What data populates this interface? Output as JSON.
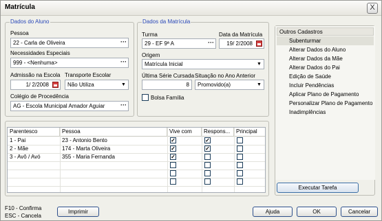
{
  "window": {
    "title": "Matrícula",
    "close": "X"
  },
  "aluno": {
    "legend": "Dados do Aluno",
    "pessoa_label": "Pessoa",
    "pessoa": "22 - Carla de Oliveira",
    "nec_label": "Necessidades Especiais",
    "nec": "999 - <Nenhuma>",
    "admissao_label": "Admissão na Escola",
    "admissao": "1/ 2/2008",
    "transporte_label": "Transporte Escolar",
    "transporte": "Não Utiliza",
    "colegio_label": "Colégio de Procedência",
    "colegio": "AG - Escola Municipal Amador Aguiar"
  },
  "matricula": {
    "legend": "Dados da Matrícula",
    "turma_label": "Turma",
    "turma": "29 - EF 9ª A",
    "data_label": "Data da Matrícula",
    "data": "19/ 2/2008",
    "origem_label": "Origem",
    "origem": "Matrícula Inicial",
    "serie_label": "Última Série Cursada",
    "serie": "8",
    "situacao_label": "Situação no Ano Anterior",
    "situacao": "Promovido(a)",
    "bolsa_label": "Bolsa Família",
    "bolsa_checked": false
  },
  "grid": {
    "headers": [
      "Parentesco",
      "Pessoa",
      "Vive com",
      "Respons...",
      "Principal"
    ],
    "rows": [
      {
        "parentesco": "1 - Pai",
        "pessoa": "23 - Antonio Bento",
        "vive": true,
        "resp": true,
        "principal": false
      },
      {
        "parentesco": "2 - Mãe",
        "pessoa": "174 - Marta Oliveira",
        "vive": true,
        "resp": true,
        "principal": false
      },
      {
        "parentesco": "3 - Avô / Avó",
        "pessoa": "355 - Maria Fernanda",
        "vive": true,
        "resp": false,
        "principal": false
      },
      {
        "parentesco": "",
        "pessoa": "",
        "vive": false,
        "resp": false,
        "principal": false
      },
      {
        "parentesco": "",
        "pessoa": "",
        "vive": false,
        "resp": false,
        "principal": false
      },
      {
        "parentesco": "",
        "pessoa": "",
        "vive": false,
        "resp": false,
        "principal": false
      }
    ]
  },
  "side": {
    "header": "Outros Cadastros",
    "items": [
      "Subenturmar",
      "Alterar Dados do Aluno",
      "Alterar Dados da Mãe",
      "Alterar Dados do Pai",
      "Edição de Saúde",
      "Incluir Pendências",
      "Aplicar Plano de Pagamento",
      "Personalizar Plano de Pagamento",
      "Inadimplências"
    ],
    "selected": 0,
    "exec": "Executar Tarefa"
  },
  "footer": {
    "f10": "F10 - Confirma",
    "esc": "ESC - Cancela",
    "imprimir": "Imprimir",
    "ajuda": "Ajuda",
    "ok": "OK",
    "cancelar": "Cancelar"
  }
}
